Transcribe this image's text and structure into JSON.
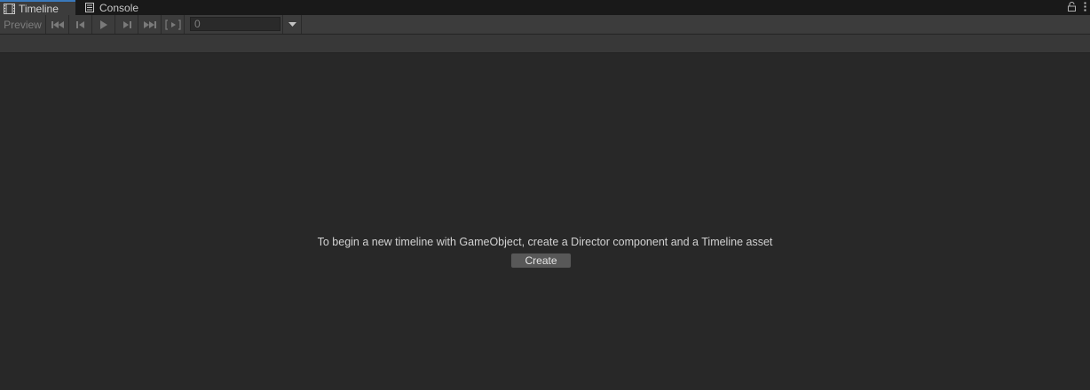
{
  "tabs": [
    {
      "label": "Timeline",
      "icon": "film-strip-icon",
      "active": true
    },
    {
      "label": "Console",
      "icon": "console-icon",
      "active": false
    }
  ],
  "tabbar_actions": {
    "lock_icon": "lock-icon",
    "menu_icon": "more-vertical-icon"
  },
  "toolbar": {
    "preview_label": "Preview",
    "controls": [
      {
        "name": "goto-start-button",
        "icon": "skip-to-start-icon"
      },
      {
        "name": "previous-frame-button",
        "icon": "step-back-icon"
      },
      {
        "name": "play-button",
        "icon": "play-icon"
      },
      {
        "name": "next-frame-button",
        "icon": "step-forward-icon"
      },
      {
        "name": "goto-end-button",
        "icon": "skip-to-end-icon"
      },
      {
        "name": "play-range-button",
        "icon": "play-range-icon"
      }
    ],
    "frame_value": "0",
    "dropdown_icon": "caret-down-icon"
  },
  "empty_state": {
    "message": "To begin a new timeline with GameObject, create a Director component and a Timeline asset",
    "create_label": "Create"
  },
  "colors": {
    "background": "#282828",
    "toolbar": "#3c3c3c",
    "active_tab_accent": "#3a79bb",
    "button": "#585858"
  }
}
